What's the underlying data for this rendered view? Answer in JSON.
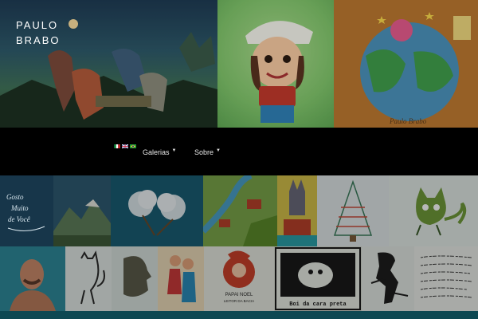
{
  "site": {
    "logo_line1": "PAULO",
    "logo_line2": "BRABO"
  },
  "languages": [
    {
      "code": "it",
      "icon": "italy-flag-icon"
    },
    {
      "code": "en",
      "icon": "uk-flag-icon"
    },
    {
      "code": "pt",
      "icon": "brazil-flag-icon"
    }
  ],
  "nav": {
    "galerias": "Galerias",
    "sobre": "Sobre"
  },
  "gallery_text": {
    "tile1": "Gosto Muito de Você",
    "tile11": "PAPAI NOEL",
    "tile11b": "LEITOR DA BACIA",
    "tile12": "Boi da cara preta"
  },
  "colors": {
    "background": "#000000",
    "teal_band": "#0d4852",
    "text": "#ffffff"
  }
}
